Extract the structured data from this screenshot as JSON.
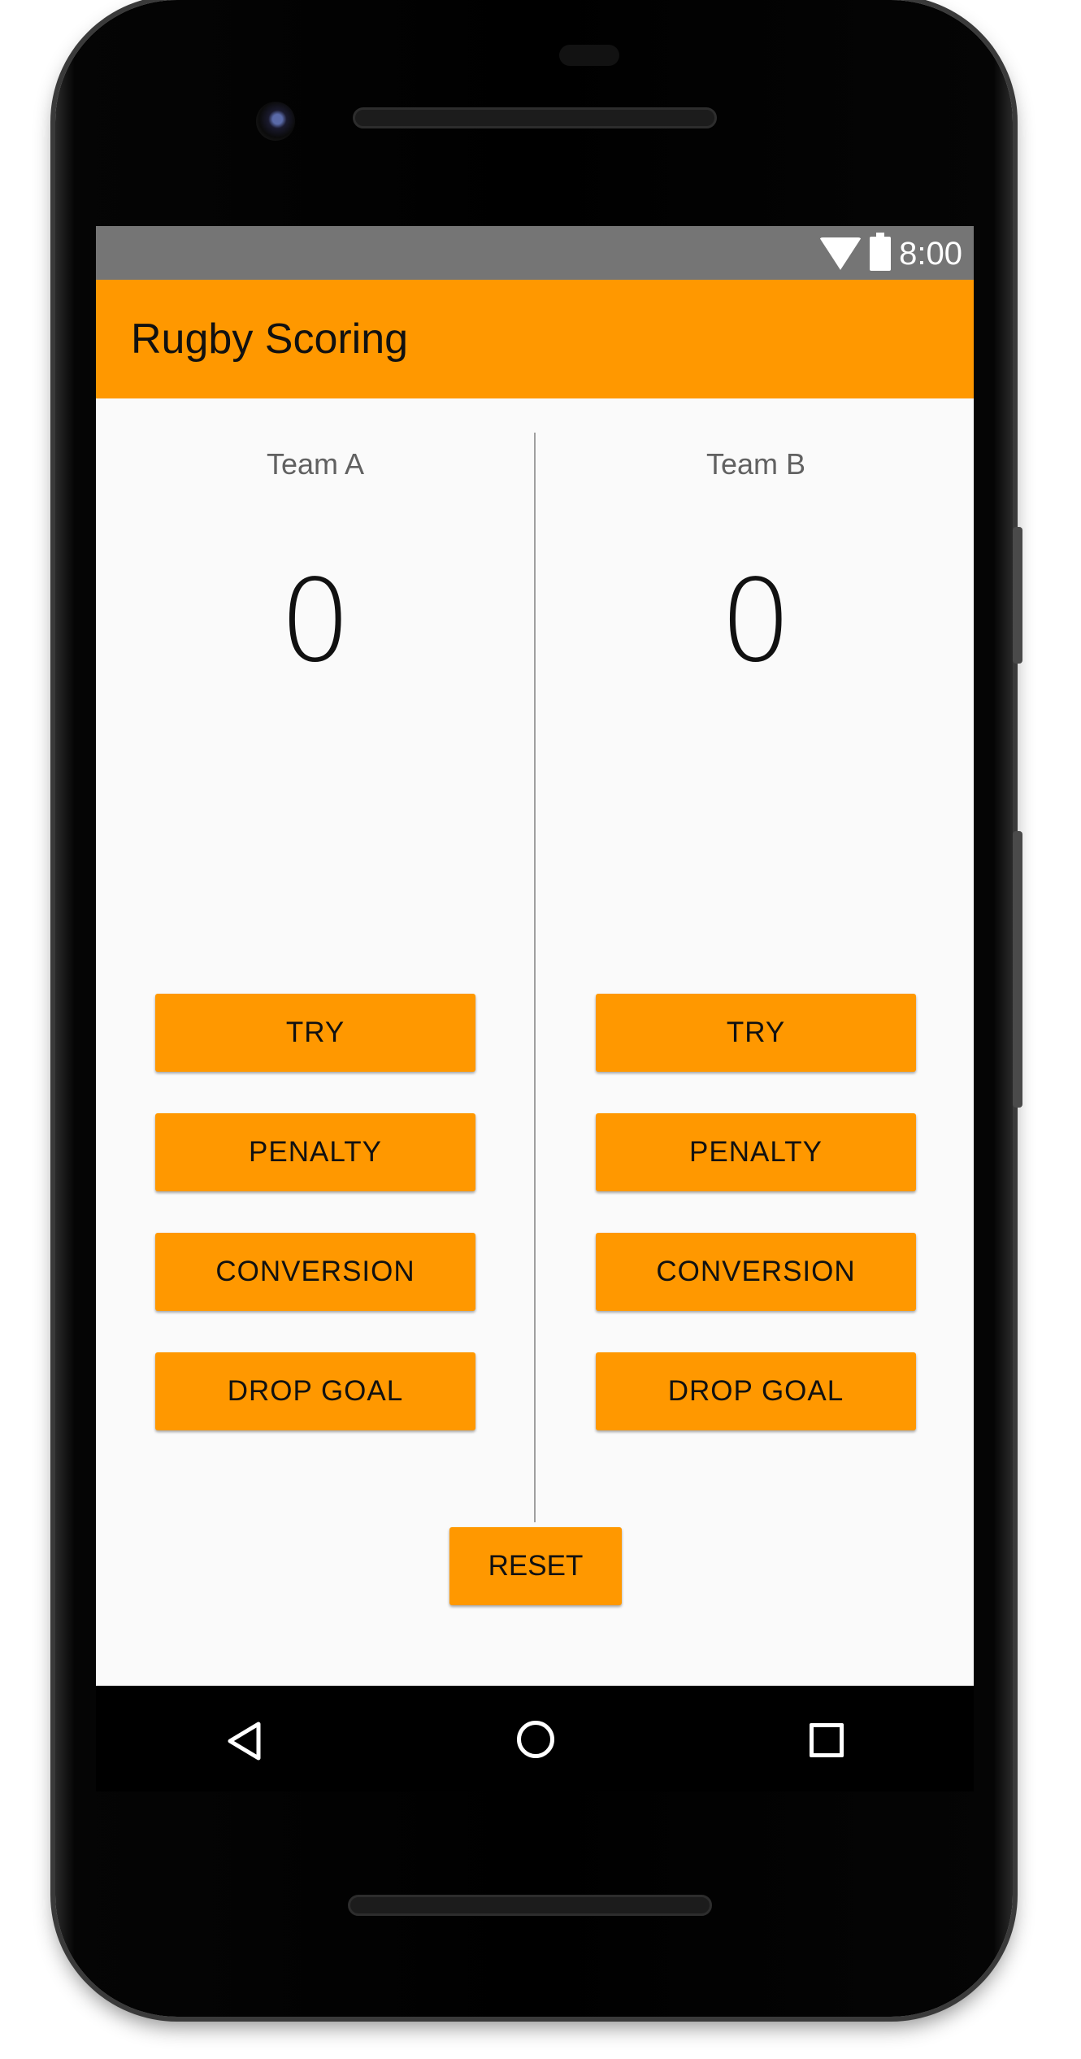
{
  "status_bar": {
    "time": "8:00",
    "icons": [
      "wifi-icon",
      "battery-icon"
    ]
  },
  "app_bar": {
    "title": "Rugby Scoring",
    "color": "#ff9800"
  },
  "team_a": {
    "name": "Team A",
    "score": "0",
    "buttons": [
      "TRY",
      "PENALTY",
      "CONVERSION",
      "DROP GOAL"
    ]
  },
  "team_b": {
    "name": "Team B",
    "score": "0",
    "buttons": [
      "TRY",
      "PENALTY",
      "CONVERSION",
      "DROP GOAL"
    ]
  },
  "reset_label": "RESET",
  "nav_bar": {
    "icons": [
      "back-icon",
      "home-icon",
      "recents-icon"
    ]
  }
}
